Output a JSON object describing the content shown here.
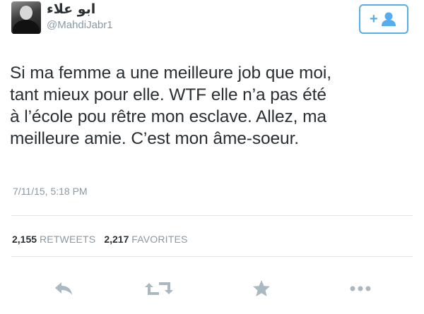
{
  "user": {
    "display_name": "ابو علاء",
    "handle": "@MahdiJabr1"
  },
  "follow_button": {
    "icon": "follow-user-icon",
    "label": "+"
  },
  "tweet": {
    "text": "Si ma femme a une meilleure job que moi,\ntant mieux pour elle. WTF elle n’a pas été\nà l’école pou rêtre mon esclave. Allez, ma\nmeilleure amie. C’est mon âme-soeur.",
    "timestamp": "7/11/15, 5:18 PM"
  },
  "stats": {
    "retweets_count": "2,155",
    "retweets_label": "RETWEETS",
    "favorites_count": "2,217",
    "favorites_label": "FAVORITES"
  },
  "actions": [
    {
      "name": "reply",
      "icon": "reply-icon"
    },
    {
      "name": "retweet",
      "icon": "retweet-icon"
    },
    {
      "name": "favorite",
      "icon": "star-icon"
    },
    {
      "name": "more",
      "icon": "more-dots-icon"
    }
  ],
  "colors": {
    "accent": "#55acee",
    "muted": "#8899a6",
    "text": "#292f33",
    "icon": "#aab8c2"
  }
}
